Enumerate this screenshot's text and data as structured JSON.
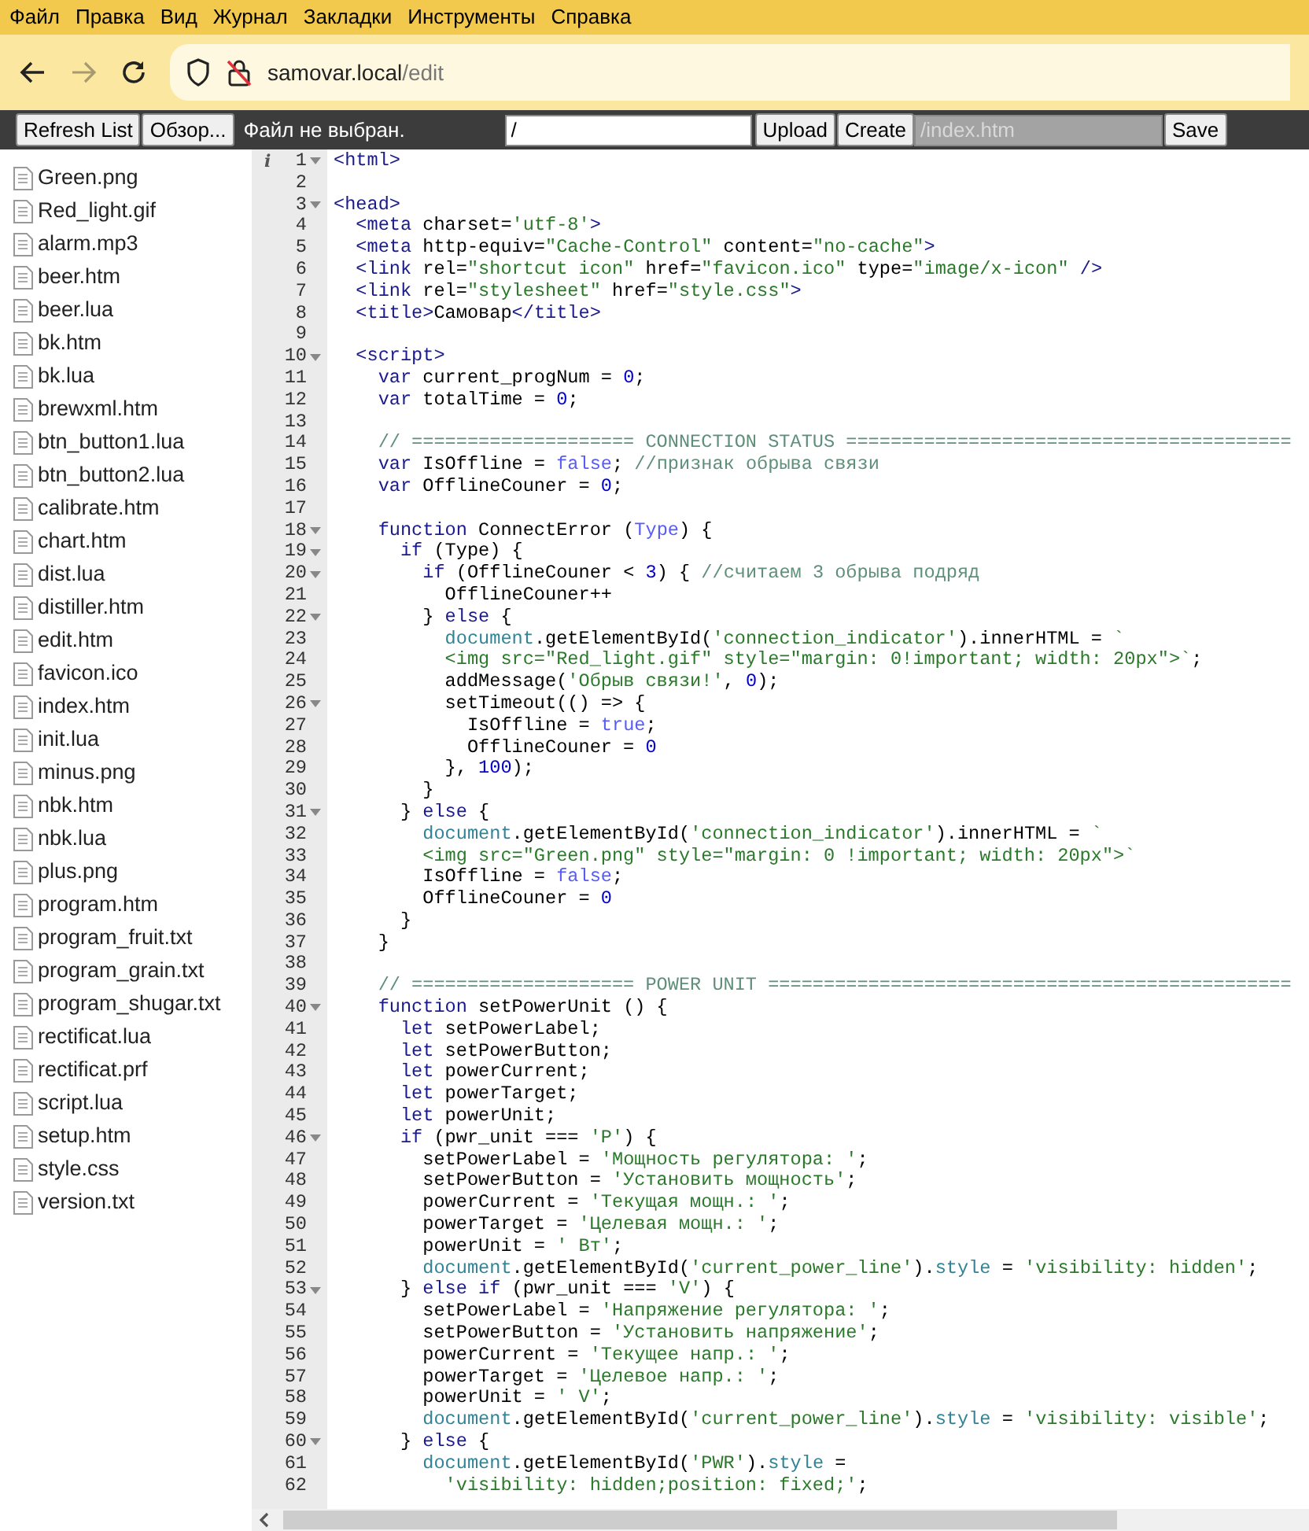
{
  "menu": [
    "Файл",
    "Правка",
    "Вид",
    "Журнал",
    "Закладки",
    "Инструменты",
    "Справка"
  ],
  "address": {
    "host": "samovar.local",
    "path": "/edit"
  },
  "toolbar": {
    "refresh": "Refresh List",
    "browse": "Обзор...",
    "file_status": "Файл не выбран.",
    "path_value": "/",
    "upload": "Upload",
    "create": "Create",
    "new_file_placeholder": "/index.htm",
    "save": "Save"
  },
  "files": [
    "Green.png",
    "Red_light.gif",
    "alarm.mp3",
    "beer.htm",
    "beer.lua",
    "bk.htm",
    "bk.lua",
    "brewxml.htm",
    "btn_button1.lua",
    "btn_button2.lua",
    "calibrate.htm",
    "chart.htm",
    "dist.lua",
    "distiller.htm",
    "edit.htm",
    "favicon.ico",
    "index.htm",
    "init.lua",
    "minus.png",
    "nbk.htm",
    "nbk.lua",
    "plus.png",
    "program.htm",
    "program_fruit.txt",
    "program_grain.txt",
    "program_shugar.txt",
    "rectificat.lua",
    "rectificat.prf",
    "script.lua",
    "setup.htm",
    "style.css",
    "version.txt"
  ],
  "editor": {
    "lines": [
      {
        "number": "1",
        "annotation": "i",
        "fold": true,
        "tokens": [
          {
            "kind": "tag",
            "text": "<html>"
          }
        ]
      },
      {
        "number": "2",
        "fold": false
      },
      {
        "number": "3",
        "fold": true,
        "tokens": [
          {
            "kind": "tag",
            "text": "<head>"
          }
        ]
      },
      {
        "number": "4",
        "fold": false,
        "tokens": [
          {
            "kind": "tag",
            "text": "  <meta"
          },
          " charset=",
          {
            "kind": "string",
            "text": "'utf-8'"
          },
          {
            "kind": "tag",
            "text": ">"
          }
        ]
      },
      {
        "number": "5",
        "fold": false,
        "tokens": [
          {
            "kind": "tag",
            "text": "  <meta"
          },
          " http-equiv=",
          {
            "kind": "string",
            "text": "\"Cache-Control\""
          },
          " content=",
          {
            "kind": "string",
            "text": "\"no-cache\""
          },
          {
            "kind": "tag",
            "text": ">"
          }
        ]
      },
      {
        "number": "6",
        "fold": false,
        "tokens": [
          {
            "kind": "tag",
            "text": "  <link"
          },
          " rel=",
          {
            "kind": "string",
            "text": "\"shortcut icon\""
          },
          " href=",
          {
            "kind": "string",
            "text": "\"favicon.ico\""
          },
          " type=",
          {
            "kind": "string",
            "text": "\"image/x-icon\""
          },
          {
            "kind": "tag",
            "text": " />"
          }
        ]
      },
      {
        "number": "7",
        "fold": false,
        "tokens": [
          {
            "kind": "tag",
            "text": "  <link"
          },
          " rel=",
          {
            "kind": "string",
            "text": "\"stylesheet\""
          },
          " href=",
          {
            "kind": "string",
            "text": "\"style.css\""
          },
          {
            "kind": "tag",
            "text": ">"
          }
        ]
      },
      {
        "number": "8",
        "fold": false,
        "tokens": [
          {
            "kind": "tag",
            "text": "  <title>"
          },
          "Самовар",
          {
            "kind": "tag",
            "text": "</title>"
          }
        ]
      },
      {
        "number": "9",
        "fold": false
      },
      {
        "number": "10",
        "fold": true,
        "tokens": [
          {
            "kind": "tag",
            "text": "  <script>"
          }
        ]
      },
      {
        "number": "11",
        "fold": false,
        "tokens": [
          {
            "kind": "keyword",
            "text": "    var"
          },
          " current_progNum = ",
          {
            "kind": "number",
            "text": "0"
          },
          ";"
        ]
      },
      {
        "number": "12",
        "fold": false,
        "tokens": [
          {
            "kind": "keyword",
            "text": "    var"
          },
          " totalTime = ",
          {
            "kind": "number",
            "text": "0"
          },
          ";"
        ]
      },
      {
        "number": "13",
        "fold": false
      },
      {
        "number": "14",
        "fold": false,
        "tokens": [
          {
            "kind": "comment",
            "text": "    // ==================== CONNECTION STATUS ========================================"
          }
        ]
      },
      {
        "number": "15",
        "fold": false,
        "tokens": [
          {
            "kind": "keyword",
            "text": "    var"
          },
          " IsOffline = ",
          {
            "kind": "constant",
            "text": "false"
          },
          "; ",
          {
            "kind": "comment",
            "text": "//признак обрыва связи"
          }
        ]
      },
      {
        "number": "16",
        "fold": false,
        "tokens": [
          {
            "kind": "keyword",
            "text": "    var"
          },
          " OfflineCouner = ",
          {
            "kind": "number",
            "text": "0"
          },
          ";"
        ]
      },
      {
        "number": "17",
        "fold": false
      },
      {
        "number": "18",
        "fold": true,
        "tokens": [
          {
            "kind": "keyword",
            "text": "    function"
          },
          " ConnectError (",
          {
            "kind": "constant",
            "text": "Type"
          },
          ") {"
        ]
      },
      {
        "number": "19",
        "fold": true,
        "tokens": [
          {
            "kind": "keyword",
            "text": "      if"
          },
          " (Type) {"
        ]
      },
      {
        "number": "20",
        "fold": true,
        "tokens": [
          {
            "kind": "keyword",
            "text": "        if"
          },
          " (OfflineCouner < ",
          {
            "kind": "number",
            "text": "3"
          },
          ") { ",
          {
            "kind": "comment",
            "text": "//считаем 3 обрыва подряд"
          }
        ]
      },
      {
        "number": "21",
        "fold": false,
        "tokens": [
          "          OfflineCouner++"
        ]
      },
      {
        "number": "22",
        "fold": true,
        "tokens": [
          "        } ",
          {
            "kind": "keyword",
            "text": "else"
          },
          " {"
        ]
      },
      {
        "number": "23",
        "fold": false,
        "tokens": [
          {
            "kind": "support",
            "text": "          document"
          },
          ".getElementById(",
          {
            "kind": "string",
            "text": "'connection_indicator'"
          },
          ").innerHTML = ",
          {
            "kind": "string",
            "text": "`"
          }
        ]
      },
      {
        "number": "24",
        "fold": false,
        "tokens": [
          {
            "kind": "string",
            "text": "          <img src=\"Red_light.gif\" style=\"margin: 0!important; width: 20px\">`"
          },
          ";"
        ]
      },
      {
        "number": "25",
        "fold": false,
        "tokens": [
          "          addMessage(",
          {
            "kind": "string",
            "text": "'Обрыв связи!'"
          },
          ", ",
          {
            "kind": "number",
            "text": "0"
          },
          ");"
        ]
      },
      {
        "number": "26",
        "fold": true,
        "tokens": [
          "          setTimeout(() => {"
        ]
      },
      {
        "number": "27",
        "fold": false,
        "tokens": [
          "            IsOffline = ",
          {
            "kind": "constant",
            "text": "true"
          },
          ";"
        ]
      },
      {
        "number": "28",
        "fold": false,
        "tokens": [
          "            OfflineCouner = ",
          {
            "kind": "number",
            "text": "0"
          }
        ]
      },
      {
        "number": "29",
        "fold": false,
        "tokens": [
          "          }, ",
          {
            "kind": "number",
            "text": "100"
          },
          ");"
        ]
      },
      {
        "number": "30",
        "fold": false,
        "tokens": [
          "        }"
        ]
      },
      {
        "number": "31",
        "fold": true,
        "tokens": [
          "      } ",
          {
            "kind": "keyword",
            "text": "else"
          },
          " {"
        ]
      },
      {
        "number": "32",
        "fold": false,
        "tokens": [
          {
            "kind": "support",
            "text": "        document"
          },
          ".getElementById(",
          {
            "kind": "string",
            "text": "'connection_indicator'"
          },
          ").innerHTML = ",
          {
            "kind": "string",
            "text": "`"
          }
        ]
      },
      {
        "number": "33",
        "fold": false,
        "tokens": [
          {
            "kind": "string",
            "text": "        <img src=\"Green.png\" style=\"margin: 0 !important; width: 20px\">`"
          }
        ]
      },
      {
        "number": "34",
        "fold": false,
        "tokens": [
          "        IsOffline = ",
          {
            "kind": "constant",
            "text": "false"
          },
          ";"
        ]
      },
      {
        "number": "35",
        "fold": false,
        "tokens": [
          "        OfflineCouner = ",
          {
            "kind": "number",
            "text": "0"
          }
        ]
      },
      {
        "number": "36",
        "fold": false,
        "tokens": [
          "      }"
        ]
      },
      {
        "number": "37",
        "fold": false,
        "tokens": [
          "    }"
        ]
      },
      {
        "number": "38",
        "fold": false
      },
      {
        "number": "39",
        "fold": false,
        "tokens": [
          {
            "kind": "comment",
            "text": "    // ==================== POWER UNIT ==============================================="
          }
        ]
      },
      {
        "number": "40",
        "fold": true,
        "tokens": [
          {
            "kind": "keyword",
            "text": "    function"
          },
          " setPowerUnit () {"
        ]
      },
      {
        "number": "41",
        "fold": false,
        "tokens": [
          {
            "kind": "keyword",
            "text": "      let"
          },
          " setPowerLabel;"
        ]
      },
      {
        "number": "42",
        "fold": false,
        "tokens": [
          {
            "kind": "keyword",
            "text": "      let"
          },
          " setPowerButton;"
        ]
      },
      {
        "number": "43",
        "fold": false,
        "tokens": [
          {
            "kind": "keyword",
            "text": "      let"
          },
          " powerCurrent;"
        ]
      },
      {
        "number": "44",
        "fold": false,
        "tokens": [
          {
            "kind": "keyword",
            "text": "      let"
          },
          " powerTarget;"
        ]
      },
      {
        "number": "45",
        "fold": false,
        "tokens": [
          {
            "kind": "keyword",
            "text": "      let"
          },
          " powerUnit;"
        ]
      },
      {
        "number": "46",
        "fold": true,
        "tokens": [
          {
            "kind": "keyword",
            "text": "      if"
          },
          " (pwr_unit === ",
          {
            "kind": "string",
            "text": "'P'"
          },
          ") {"
        ]
      },
      {
        "number": "47",
        "fold": false,
        "tokens": [
          "        setPowerLabel = ",
          {
            "kind": "string",
            "text": "'Мощность регулятора: '"
          },
          ";"
        ]
      },
      {
        "number": "48",
        "fold": false,
        "tokens": [
          "        setPowerButton = ",
          {
            "kind": "string",
            "text": "'Установить мощность'"
          },
          ";"
        ]
      },
      {
        "number": "49",
        "fold": false,
        "tokens": [
          "        powerCurrent = ",
          {
            "kind": "string",
            "text": "'Текущая мощн.: '"
          },
          ";"
        ]
      },
      {
        "number": "50",
        "fold": false,
        "tokens": [
          "        powerTarget = ",
          {
            "kind": "string",
            "text": "'Целевая мощн.: '"
          },
          ";"
        ]
      },
      {
        "number": "51",
        "fold": false,
        "tokens": [
          "        powerUnit = ",
          {
            "kind": "string",
            "text": "' Вт'"
          },
          ";"
        ]
      },
      {
        "number": "52",
        "fold": false,
        "tokens": [
          {
            "kind": "support",
            "text": "        document"
          },
          ".getElementById(",
          {
            "kind": "string",
            "text": "'current_power_line'"
          },
          ").",
          {
            "kind": "support",
            "text": "style"
          },
          " = ",
          {
            "kind": "string",
            "text": "'visibility: hidden'"
          },
          ";"
        ]
      },
      {
        "number": "53",
        "fold": true,
        "tokens": [
          "      } ",
          {
            "kind": "keyword",
            "text": "else if"
          },
          " (pwr_unit === ",
          {
            "kind": "string",
            "text": "'V'"
          },
          ") {"
        ]
      },
      {
        "number": "54",
        "fold": false,
        "tokens": [
          "        setPowerLabel = ",
          {
            "kind": "string",
            "text": "'Напряжение регулятора: '"
          },
          ";"
        ]
      },
      {
        "number": "55",
        "fold": false,
        "tokens": [
          "        setPowerButton = ",
          {
            "kind": "string",
            "text": "'Установить напряжение'"
          },
          ";"
        ]
      },
      {
        "number": "56",
        "fold": false,
        "tokens": [
          "        powerCurrent = ",
          {
            "kind": "string",
            "text": "'Текущее напр.: '"
          },
          ";"
        ]
      },
      {
        "number": "57",
        "fold": false,
        "tokens": [
          "        powerTarget = ",
          {
            "kind": "string",
            "text": "'Целевое напр.: '"
          },
          ";"
        ]
      },
      {
        "number": "58",
        "fold": false,
        "tokens": [
          "        powerUnit = ",
          {
            "kind": "string",
            "text": "' V'"
          },
          ";"
        ]
      },
      {
        "number": "59",
        "fold": false,
        "tokens": [
          {
            "kind": "support",
            "text": "        document"
          },
          ".getElementById(",
          {
            "kind": "string",
            "text": "'current_power_line'"
          },
          ").",
          {
            "kind": "support",
            "text": "style"
          },
          " = ",
          {
            "kind": "string",
            "text": "'visibility: visible'"
          },
          ";"
        ]
      },
      {
        "number": "60",
        "fold": true,
        "tokens": [
          "      } ",
          {
            "kind": "keyword",
            "text": "else"
          },
          " {"
        ]
      },
      {
        "number": "61",
        "fold": false,
        "tokens": [
          {
            "kind": "support",
            "text": "        document"
          },
          ".getElementById(",
          {
            "kind": "string",
            "text": "'PWR'"
          },
          ").",
          {
            "kind": "support",
            "text": "style"
          },
          " ="
        ]
      },
      {
        "number": "62",
        "fold": false,
        "tokens": [
          {
            "kind": "string",
            "text": "          'visibility: hidden;position: fixed;'"
          },
          ";"
        ]
      }
    ]
  }
}
